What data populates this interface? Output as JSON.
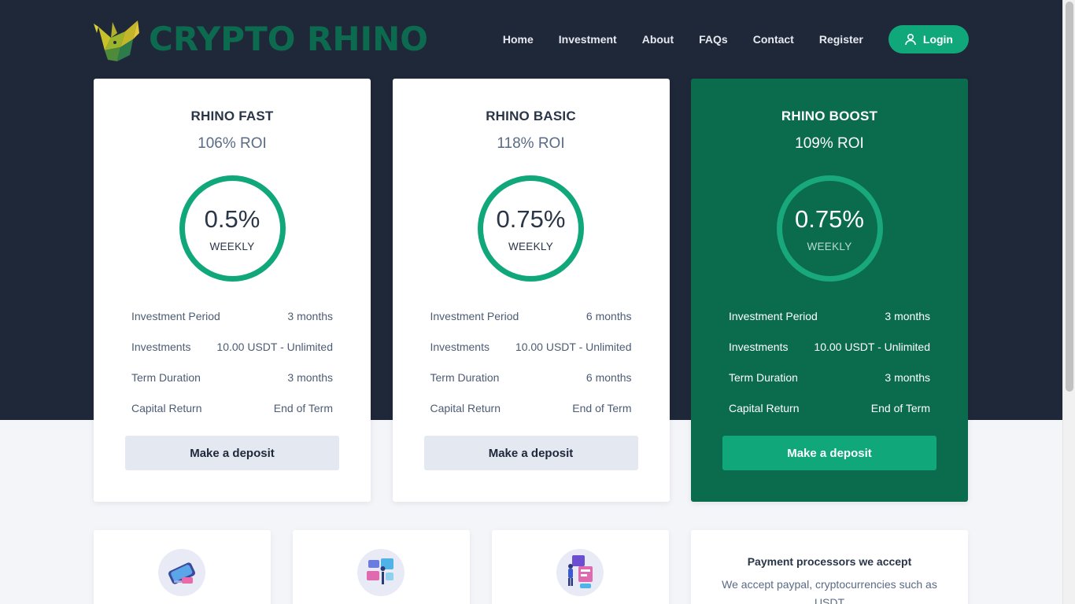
{
  "brand": {
    "name": "CRYPTO RHINO"
  },
  "nav": {
    "items": [
      "Home",
      "Investment",
      "About",
      "FAQs",
      "Contact",
      "Register"
    ],
    "login_label": "Login"
  },
  "plans": [
    {
      "title": "RHINO FAST",
      "roi": "106% ROI",
      "rate": "0.5%",
      "period_unit": "WEEKLY",
      "rows": [
        {
          "label": "Investment Period",
          "value": "3 months"
        },
        {
          "label": "Investments",
          "value": "10.00 USDT - Unlimited"
        },
        {
          "label": "Term Duration",
          "value": "3 months"
        },
        {
          "label": "Capital Return",
          "value": "End of Term"
        }
      ],
      "cta": "Make a deposit"
    },
    {
      "title": "RHINO BASIC",
      "roi": "118% ROI",
      "rate": "0.75%",
      "period_unit": "WEEKLY",
      "rows": [
        {
          "label": "Investment Period",
          "value": "6 months"
        },
        {
          "label": "Investments",
          "value": "10.00 USDT - Unlimited"
        },
        {
          "label": "Term Duration",
          "value": "6 months"
        },
        {
          "label": "Capital Return",
          "value": "End of Term"
        }
      ],
      "cta": "Make a deposit"
    },
    {
      "title": "RHINO BOOST",
      "roi": "109% ROI",
      "rate": "0.75%",
      "period_unit": "WEEKLY",
      "rows": [
        {
          "label": "Investment Period",
          "value": "3 months"
        },
        {
          "label": "Investments",
          "value": "10.00 USDT - Unlimited"
        },
        {
          "label": "Term Duration",
          "value": "3 months"
        },
        {
          "label": "Capital Return",
          "value": "End of Term"
        }
      ],
      "cta": "Make a deposit"
    }
  ],
  "payments": {
    "title": "Payment processors we accept",
    "text": "We accept paypal, cryptocurrencies such as USDT"
  },
  "colors": {
    "accent": "#10a77a",
    "dark_navy": "#1f2839",
    "featured_green": "#0a6b4d",
    "brand_green": "#0c6b4e"
  },
  "icons": [
    "user-icon",
    "rhino-logo-icon",
    "mobile-payment-icon",
    "dashboard-analytics-icon",
    "chart-presentation-icon"
  ]
}
